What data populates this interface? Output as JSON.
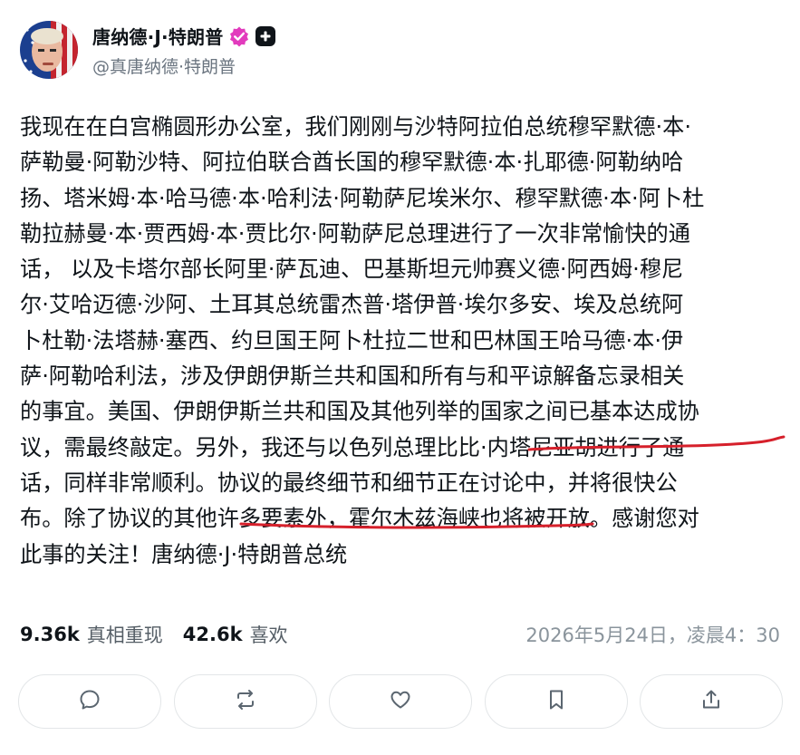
{
  "author": {
    "display_name": "唐纳德·J·特朗普",
    "handle": "@真唐纳德·特朗普",
    "verified_icon": "verified-badge-icon",
    "plus_icon": "plus-badge-icon"
  },
  "post": {
    "text": "我现在在白宫椭圆形办公室，我们刚刚与沙特阿拉伯总统穆罕默德·本·\n萨勒曼·阿勒沙特、阿拉伯联合酋长国的穆罕默德·本·扎耶德·阿勒纳哈\n扬、塔米姆·本·哈马德·本·哈利法·阿勒萨尼埃米尔、穆罕默德·本·阿卜杜\n勒拉赫曼·本·贾西姆·本·贾比尔·阿勒萨尼总理进行了一次非常愉快的通\n话， 以及卡塔尔部长阿里·萨瓦迪、巴基斯坦元帅赛义德·阿西姆·穆尼\n尔·艾哈迈德·沙阿、土耳其总统雷杰普·塔伊普·埃尔多安、埃及总统阿\n卜杜勒·法塔赫·塞西、约旦国王阿卜杜拉二世和巴林国王哈马德·本·伊\n萨·阿勒哈利法，涉及伊朗伊斯兰共和国和所有与和平谅解备忘录相关\n的事宜。美国、伊朗伊斯兰共和国及其他列举的国家之间已基本达成协\n议，需最终敲定。另外，我还与以色列总理比比·内塔尼亚胡进行了通\n话，同样非常顺利。协议的最终细节和细节正在讨论中，并将很快公\n布。除了协议的其他许多要素外，霍尔木兹海峡也将被开放。感谢您对\n此事的关注！唐纳德·J·特朗普总统"
  },
  "stats": {
    "reposts_count": "9.36k",
    "reposts_label": "真相重现",
    "likes_count": "42.6k",
    "likes_label": "喜欢"
  },
  "timestamp": "2026年5月24日，凌晨4：30",
  "actions": [
    "reply-icon",
    "repost-icon",
    "heart-icon",
    "bookmark-icon",
    "share-icon"
  ],
  "colors": {
    "text": "#0f1419",
    "muted": "#6b7580",
    "verified": "#e23bbd",
    "underline": "#d6202b",
    "border": "#e3e6e8"
  }
}
